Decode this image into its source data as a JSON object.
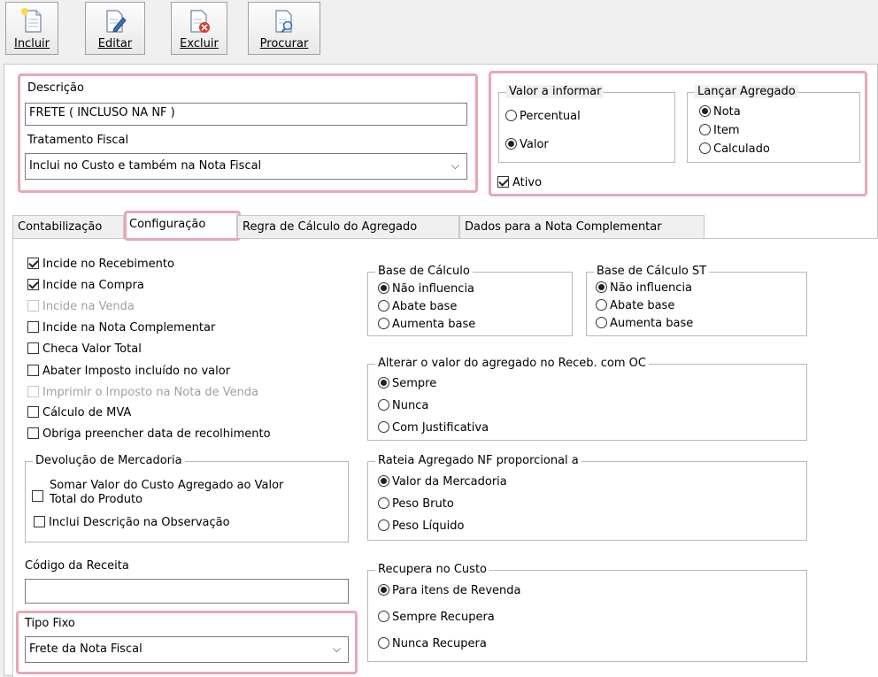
{
  "toolbar": {
    "buttons": [
      {
        "label": "Incluir"
      },
      {
        "label": "Editar"
      },
      {
        "label": "Excluir"
      },
      {
        "label": "Procurar"
      }
    ]
  },
  "form": {
    "descricao_label": "Descrição",
    "descricao_value": "FRETE ( INCLUSO NA NF )",
    "tratamento_label": "Tratamento Fiscal",
    "tratamento_value": "Inclui no Custo e também na Nota Fiscal",
    "valor_informar": {
      "title": "Valor a informar",
      "options": [
        "Percentual",
        "Valor"
      ],
      "selected": "Valor"
    },
    "lancar_agregado": {
      "title": "Lançar Agregado",
      "options": [
        "Nota",
        "Item",
        "Calculado"
      ],
      "selected": "Nota"
    },
    "ativo_label": "Ativo",
    "ativo_checked": true
  },
  "tabs": [
    {
      "label": "Contabilização"
    },
    {
      "label": "Configuração",
      "active": true
    },
    {
      "label": "Regra de Cálculo do Agregado"
    },
    {
      "label": "Dados para a Nota Complementar"
    }
  ],
  "config": {
    "checkboxes": [
      {
        "label": "Incide no Recebimento",
        "checked": true,
        "disabled": false
      },
      {
        "label": "Incide na Compra",
        "checked": true,
        "disabled": false
      },
      {
        "label": "Incide na Venda",
        "checked": false,
        "disabled": true
      },
      {
        "label": "Incide na Nota Complementar",
        "checked": false,
        "disabled": false
      },
      {
        "label": "Checa Valor Total",
        "checked": false,
        "disabled": false
      },
      {
        "label": "Abater Imposto incluído no valor",
        "checked": false,
        "disabled": false
      },
      {
        "label": "Imprimir o Imposto na Nota de Venda",
        "checked": false,
        "disabled": true
      },
      {
        "label": "Cálculo de MVA",
        "checked": false,
        "disabled": false
      },
      {
        "label": "Obriga preencher data de recolhimento",
        "checked": false,
        "disabled": false
      }
    ],
    "devolucao": {
      "title": "Devolução de Mercadoria",
      "somar_line1": "Somar Valor do Custo Agregado ao Valor",
      "somar_line2": "Total do Produto",
      "inclui_descricao": "Inclui Descrição na Observação"
    },
    "codigo_receita_label": "Código da Receita",
    "codigo_receita_value": "",
    "tipo_fixo_label": "Tipo Fixo",
    "tipo_fixo_value": "Frete da Nota Fiscal",
    "base_calculo": {
      "title": "Base de Cálculo",
      "options": [
        "Não influencia",
        "Abate base",
        "Aumenta base"
      ],
      "selected": "Não influencia"
    },
    "base_calculo_st": {
      "title": "Base de Cálculo ST",
      "options": [
        "Não influencia",
        "Abate base",
        "Aumenta base"
      ],
      "selected": "Não influencia"
    },
    "alterar_valor": {
      "title": "Alterar o valor do agregado no Receb. com OC",
      "options": [
        "Sempre",
        "Nunca",
        "Com Justificativa"
      ],
      "selected": "Sempre"
    },
    "rateia": {
      "title": "Rateia Agregado NF proporcional a",
      "options": [
        "Valor da Mercadoria",
        "Peso Bruto",
        "Peso Líquido"
      ],
      "selected": "Valor da Mercadoria"
    },
    "recupera": {
      "title": "Recupera no Custo",
      "options": [
        "Para itens de Revenda",
        "Sempre Recupera",
        "Nunca Recupera"
      ],
      "selected": "Para itens de Revenda"
    }
  }
}
